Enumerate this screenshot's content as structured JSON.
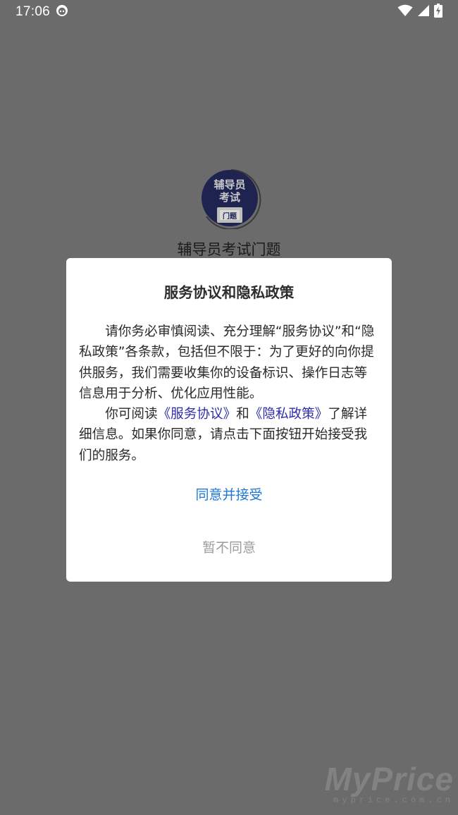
{
  "status_bar": {
    "time": "17:06"
  },
  "splash": {
    "logo_text_line1": "辅导员",
    "logo_text_line2": "考试",
    "logo_badge": "门题",
    "app_name": "辅导员考试门题"
  },
  "dialog": {
    "title": "服务协议和隐私政策",
    "paragraph1": "请你务必审慎阅读、充分理解“服务协议”和“隐私政策”各条款，包括但不限于：为了更好的向你提供服务，我们需要收集你的设备标识、操作日志等信息用于分析、优化应用性能。",
    "paragraph2_prefix": "你可阅读",
    "service_link": "《服务协议》",
    "paragraph2_and": "和",
    "privacy_link": "《隐私政策》",
    "paragraph2_suffix": "了解详细信息。如果你同意，请点击下面按钮开始接受我们的服务。",
    "agree_button": "同意并接受",
    "disagree_button": "暂不同意"
  },
  "watermark": {
    "main": "MyPrice",
    "sub": "myprice.com.cn"
  },
  "colors": {
    "overlay_background": "#6b6b6b",
    "link": "#2e2ea8",
    "agree": "#1e78d8",
    "disagree": "#9c9c9c"
  }
}
